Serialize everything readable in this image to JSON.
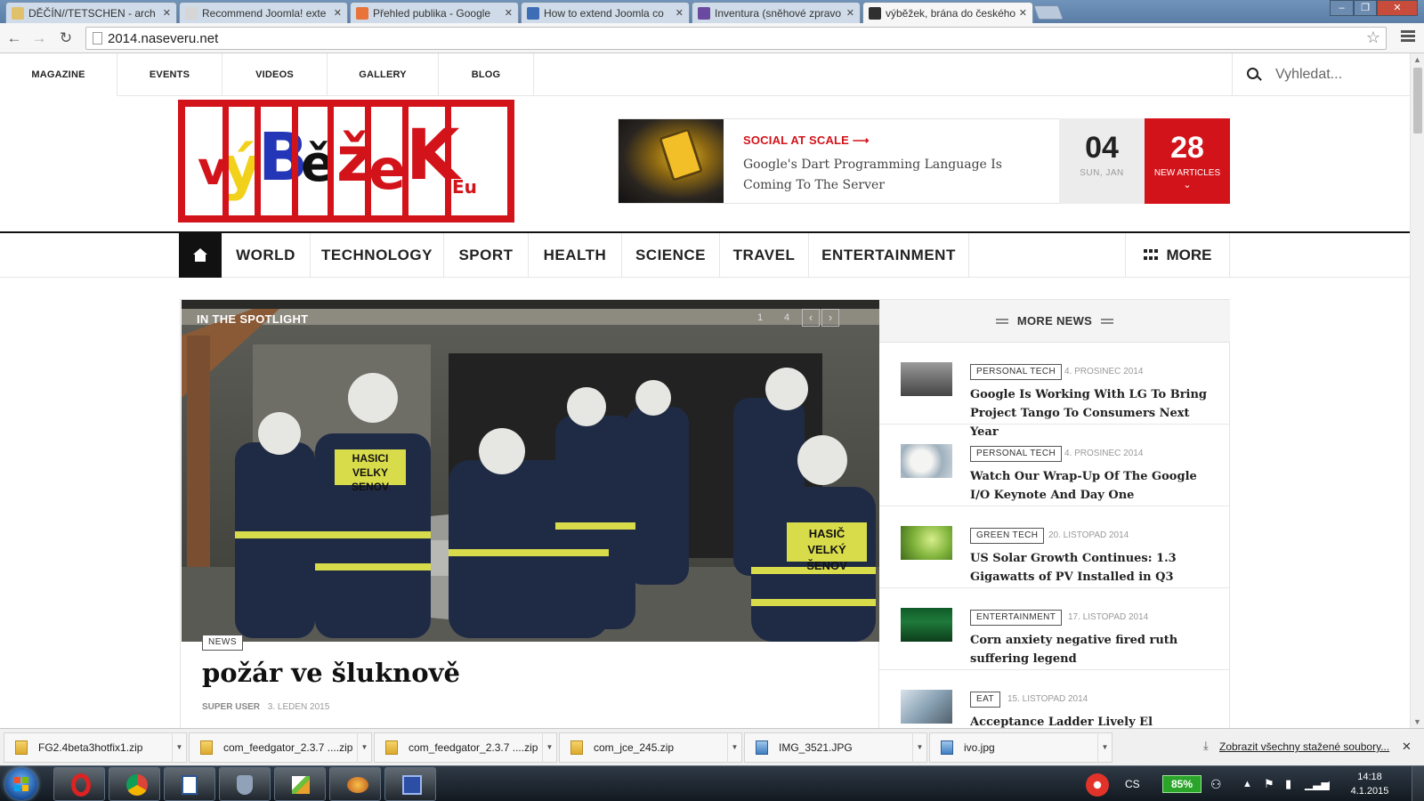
{
  "browser": {
    "tabs": [
      {
        "title": "DĚČÍN//TETSCHEN - arch",
        "favicon_color": "#e0c06a"
      },
      {
        "title": "Recommend Joomla! exte",
        "favicon_color": "#d6d6d6"
      },
      {
        "title": "Přehled publika - Google",
        "favicon_color": "#e8743b"
      },
      {
        "title": "How to extend Joomla co",
        "favicon_color": "#3c6db5"
      },
      {
        "title": "Inventura (sněhové zpravo",
        "favicon_color": "#6a4aa0"
      },
      {
        "title": "výběžek, brána do českého",
        "favicon_color": "#2f2f2f"
      }
    ],
    "active_tab_index": 5,
    "url": "2014.naseveru.net",
    "window_controls": {
      "minimize": "–",
      "maximize": "❐",
      "close": "✕"
    }
  },
  "site": {
    "top_menu": [
      "MAGAZINE",
      "EVENTS",
      "VIDEOS",
      "GALLERY",
      "BLOG"
    ],
    "active_top_menu": "MAGAZINE",
    "search_placeholder": "Vyhledat...",
    "logo_text": "výBěžeK",
    "logo_suffix": "Eu",
    "feature": {
      "kicker": "SOCIAL AT SCALE ⟶",
      "headline": "Google's Dart Programming Language Is Coming To The Server"
    },
    "date": {
      "day": "04",
      "sub": "SUN, JAN"
    },
    "new_articles": {
      "count": "28",
      "label": "NEW ARTICLES",
      "chevron": "⌄"
    },
    "main_menu": [
      "WORLD",
      "TECHNOLOGY",
      "SPORT",
      "HEALTH",
      "SCIENCE",
      "TRAVEL",
      "ENTERTAINMENT"
    ],
    "more_label": "MORE",
    "spotlight": {
      "label": "IN THE SPOTLIGHT",
      "pager": [
        "1",
        "4"
      ],
      "prev": "‹",
      "next": "›",
      "badge": "NEWS",
      "title": "požár ve šluknově",
      "author": "SUPER USER",
      "date": "3. LEDEN 2015",
      "vest_text_1": "HASICI",
      "vest_text_2": "VELKY SENOV",
      "vest_text_3": "HASIČ",
      "vest_text_4": "VELKÝ ŠENOV"
    },
    "more_news": {
      "header": "MORE NEWS",
      "items": [
        {
          "tag": "PERSONAL TECH",
          "date": "4. PROSINEC 2014",
          "title": "Google Is Working With LG To Bring Project Tango To Consumers Next Year",
          "thumb": "#6a6a6a"
        },
        {
          "tag": "PERSONAL TECH",
          "date": "4. PROSINEC 2014",
          "title": "Watch Our Wrap-Up Of The Google I/O Keynote And Day One",
          "thumb": "#c9d3da"
        },
        {
          "tag": "GREEN TECH",
          "date": "20. LISTOPAD 2014",
          "title": "US Solar Growth Continues: 1.3 Gigawatts of PV Installed in Q3",
          "thumb": "#7fb23b"
        },
        {
          "tag": "ENTERTAINMENT",
          "date": "17. LISTOPAD 2014",
          "title": "Corn anxiety negative fired ruth suffering legend",
          "thumb": "#1f7a3a"
        },
        {
          "tag": "EAT",
          "date": "15. LISTOPAD 2014",
          "title": "Acceptance Ladder Lively El",
          "thumb": "#8aa3b5"
        }
      ]
    }
  },
  "downloads": {
    "items": [
      {
        "name": "FG2.4beta3hotfix1.zip",
        "type": "zip"
      },
      {
        "name": "com_feedgator_2.3.7 ....zip",
        "type": "zip"
      },
      {
        "name": "com_feedgator_2.3.7 ....zip",
        "type": "zip"
      },
      {
        "name": "com_jce_245.zip",
        "type": "zip"
      },
      {
        "name": "IMG_3521.JPG",
        "type": "image"
      },
      {
        "name": "ivo.jpg",
        "type": "image"
      }
    ],
    "show_all": "Zobrazit všechny stažené soubory...",
    "close": "✕"
  },
  "taskbar": {
    "language": "CS",
    "battery": "85%",
    "time": "14:18",
    "date": "4.1.2015"
  },
  "colors": {
    "brand_red": "#d3131a",
    "logo_yellow": "#f2d11a",
    "logo_blue": "#2336b8"
  }
}
